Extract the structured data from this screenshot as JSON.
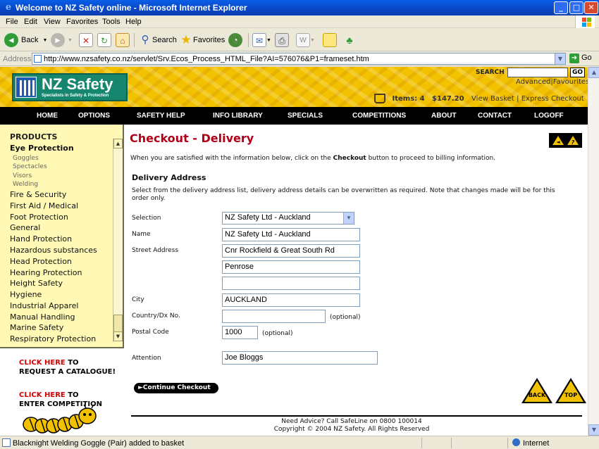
{
  "window": {
    "title": "Welcome to NZ Safety online - Microsoft Internet Explorer",
    "controls": {
      "minimize": "_",
      "maximize": "□",
      "close": "✕"
    }
  },
  "menu": [
    "File",
    "Edit",
    "View",
    "Favorites",
    "Tools",
    "Help"
  ],
  "toolbar": {
    "back": "Back",
    "search": "Search",
    "favorites": "Favorites"
  },
  "address": {
    "label": "Address",
    "url": "http://www.nzsafety.co.nz/servlet/Srv.Ecos_Process_HTML_File?AI=576076&P1=frameset.htm",
    "go": "Go"
  },
  "header": {
    "logo_name": "NZ Safety",
    "logo_tagline": "Specialists in Safety & Protection",
    "search_label": "SEARCH",
    "search_go": "GO",
    "advanced": "Advanced",
    "favourites": "Favourites",
    "cart": {
      "items_label": "Items:",
      "items": "4",
      "total": "$147.20",
      "view_basket": "View Basket",
      "express_checkout": "Express Checkout"
    }
  },
  "nav": [
    "HOME",
    "OPTIONS",
    "SAFETY HELP",
    "INFO LIBRARY",
    "SPECIALS",
    "COMPETITIONS",
    "ABOUT",
    "CONTACT",
    "LOGOFF"
  ],
  "sidebar": {
    "title": "PRODUCTS",
    "active": "Eye Protection",
    "subitems": [
      "Goggles",
      "Spectacles",
      "Visors",
      "Welding"
    ],
    "categories": [
      "Fire & Security",
      "First Aid / Medical",
      "Foot Protection",
      "General",
      "Hand Protection",
      "Hazardous substances",
      "Head Protection",
      "Hearing Protection",
      "Height Safety",
      "Hygiene",
      "Industrial Apparel",
      "Manual Handling",
      "Marine Safety",
      "Respiratory Protection"
    ]
  },
  "promos": {
    "catalogue_click": "CLICK HERE",
    "catalogue_to": " TO",
    "catalogue_rest": "REQUEST A CATALOGUE!",
    "competition_click": "CLICK HERE",
    "competition_to": " TO",
    "competition_rest": "ENTER COMPETITION"
  },
  "checkout": {
    "title": "Checkout - Delivery",
    "intro_before": "When you are satisfied with the information below, click on the ",
    "intro_bold": "Checkout",
    "intro_after": " button to proceed to billing information.",
    "section": "Delivery Address",
    "description": "Select from the delivery address list, delivery address details can be overwritten as required. Note that changes made will be for this order only.",
    "labels": {
      "selection": "Selection",
      "name": "Name",
      "street": "Street Address",
      "city": "City",
      "country": "Country/Dx No.",
      "postal": "Postal Code",
      "attention": "Attention"
    },
    "values": {
      "selection": "NZ Safety Ltd - Auckland",
      "name": "NZ Safety Ltd - Auckland",
      "street1": "Cnr Rockfield & Great South Rd",
      "street2": "Penrose",
      "street3": "",
      "city": "AUCKLAND",
      "country": "",
      "postal": "1000",
      "attention": "Joe Bloggs"
    },
    "optional": "(optional)",
    "continue": "►Continue Checkout",
    "back": "BACK",
    "top": "TOP"
  },
  "footer": {
    "advice": "Need Advice? Call SafeLine on 0800 100014",
    "copyright": "Copyright © 2004 NZ Safety. All Rights Reserved"
  },
  "status": {
    "text": "Blacknight Welding Goggle (Pair) added to basket",
    "zone": "Internet"
  }
}
